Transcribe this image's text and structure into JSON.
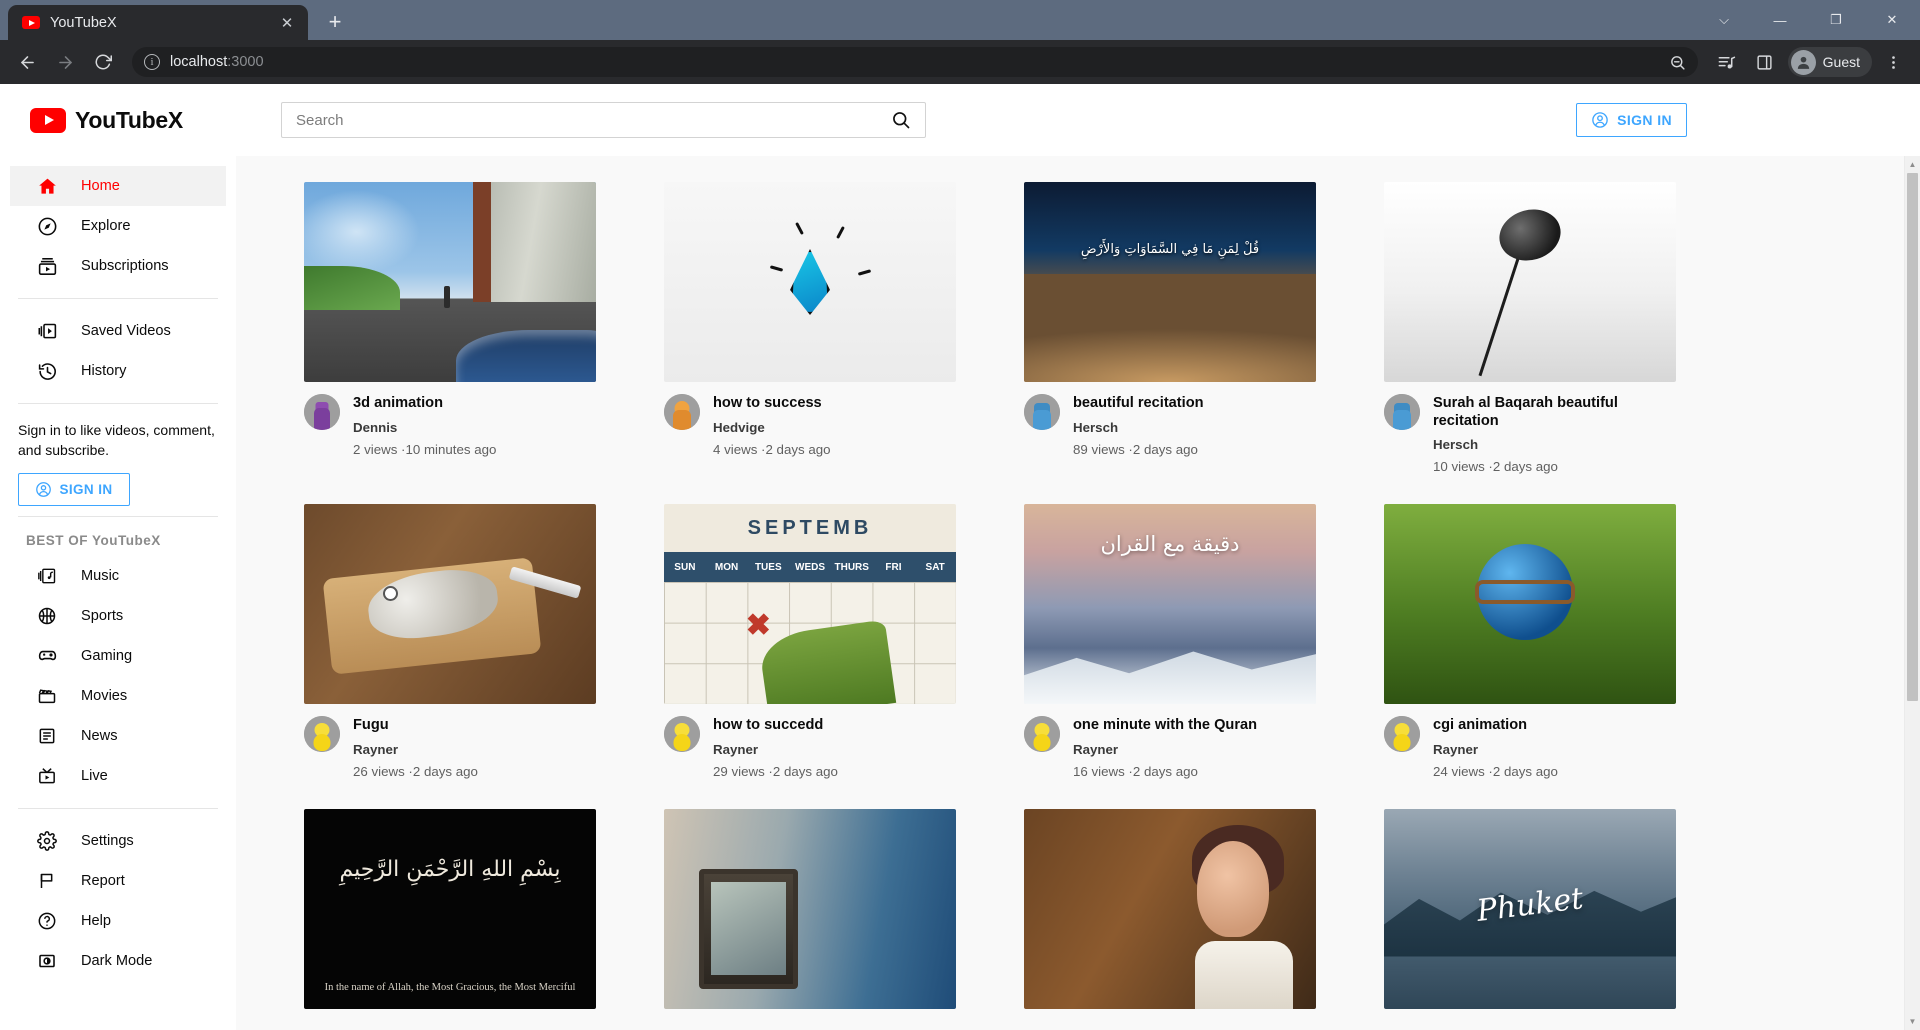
{
  "browser": {
    "tab": {
      "title": "YouTubeX",
      "favicon": "youtube-favicon",
      "close_label": "✕"
    },
    "new_tab_label": "+",
    "window_controls": {
      "minimize": "—",
      "maximize": "❐",
      "close": "✕",
      "restore_down": "⌵"
    },
    "nav": {
      "back": "←",
      "forward": "→",
      "reload": "⟳"
    },
    "omnibox": {
      "info_icon": "ⓘ",
      "url_host": "localhost",
      "url_port": ":3000"
    },
    "toolbar_icons": [
      "search-icon",
      "media-playlist-icon",
      "side-panel-icon",
      "more-menu-icon"
    ],
    "profile": {
      "name": "Guest",
      "avatar": "person-icon"
    }
  },
  "header": {
    "brand": "YouTubeX",
    "search": {
      "placeholder": "Search",
      "value": ""
    },
    "sign_in_label": "SIGN IN"
  },
  "sidebar": {
    "primary": [
      {
        "label": "Home",
        "icon": "home-icon",
        "active": true
      },
      {
        "label": "Explore",
        "icon": "compass-icon",
        "active": false
      },
      {
        "label": "Subscriptions",
        "icon": "subscriptions-icon",
        "active": false
      }
    ],
    "library": [
      {
        "label": "Saved Videos",
        "icon": "saved-videos-icon",
        "active": false
      },
      {
        "label": "History",
        "icon": "history-icon",
        "active": false
      }
    ],
    "signin_prompt": "Sign in to like videos, comment, and subscribe.",
    "signin_label": "SIGN IN",
    "section_title": "BEST OF YouTubeX",
    "categories": [
      {
        "label": "Music",
        "icon": "music-icon"
      },
      {
        "label": "Sports",
        "icon": "sports-icon"
      },
      {
        "label": "Gaming",
        "icon": "gaming-icon"
      },
      {
        "label": "Movies",
        "icon": "movies-icon"
      },
      {
        "label": "News",
        "icon": "news-icon"
      },
      {
        "label": "Live",
        "icon": "live-icon"
      }
    ],
    "settings": [
      {
        "label": "Settings",
        "icon": "gear-icon"
      },
      {
        "label": "Report",
        "icon": "flag-icon"
      },
      {
        "label": "Help",
        "icon": "help-icon"
      },
      {
        "label": "Dark Mode",
        "icon": "dark-mode-icon"
      }
    ]
  },
  "videos": [
    {
      "title": "3d animation",
      "channel": "Dennis",
      "views": "2 views",
      "age": "10 minutes ago",
      "thumb": "t-3d",
      "avatar": "av-purple"
    },
    {
      "title": "how to success",
      "channel": "Hedvige",
      "views": "4 views",
      "age": "2 days ago",
      "thumb": "t-drop",
      "avatar": "av-orange"
    },
    {
      "title": "beautiful recitation",
      "channel": "Hersch",
      "views": "89 views",
      "age": "2 days ago",
      "thumb": "t-earth",
      "avatar": "av-blue",
      "overlay_text": "قُلْ لِمَنِ مَا فِي السَّمَاوَاتِ وَالأَرْضِ"
    },
    {
      "title": "Surah al Baqarah beautiful recitation",
      "channel": "Hersch",
      "views": "10 views",
      "age": "2 days ago",
      "thumb": "t-mic",
      "avatar": "av-blue"
    },
    {
      "title": "Fugu",
      "channel": "Rayner",
      "views": "26 views",
      "age": "2 days ago",
      "thumb": "t-fish",
      "avatar": "av-yellow"
    },
    {
      "title": "how to succedd",
      "channel": "Rayner",
      "views": "29 views",
      "age": "2 days ago",
      "thumb": "t-cal",
      "avatar": "av-yellow",
      "overlay_text": "SEPTEMB"
    },
    {
      "title": "one minute with the Quran",
      "channel": "Rayner",
      "views": "16 views",
      "age": "2 days ago",
      "thumb": "t-quran",
      "avatar": "av-yellow",
      "overlay_text": "دقيقة مع القران"
    },
    {
      "title": "cgi animation",
      "channel": "Rayner",
      "views": "24 views",
      "age": "2 days ago",
      "thumb": "t-cgi",
      "avatar": "av-yellow"
    },
    {
      "title": "",
      "channel": "",
      "views": "",
      "age": "",
      "thumb": "t-bism",
      "avatar": "av-yellow",
      "overlay_text": "بِسْمِ اللهِ الرَّحْمَنِ الرَّحِيمِ",
      "overlay_sub": "In the name of Allah, the Most Gracious, the Most Merciful"
    },
    {
      "title": "",
      "channel": "",
      "views": "",
      "age": "",
      "thumb": "t-kitchen",
      "avatar": "av-yellow"
    },
    {
      "title": "",
      "channel": "",
      "views": "",
      "age": "",
      "thumb": "t-rat",
      "avatar": "av-yellow"
    },
    {
      "title": "",
      "channel": "",
      "views": "",
      "age": "",
      "thumb": "t-phuket",
      "avatar": "av-yellow",
      "overlay_text": "Phuket"
    }
  ],
  "calendar_days": [
    "SUN",
    "MON",
    "TUES",
    "WEDS",
    "THURS",
    "FRI",
    "SAT"
  ],
  "colors": {
    "brand_red": "#ff0000",
    "accent_blue": "#3ea6ff",
    "page_bg": "#f9f9f9",
    "chrome_bg": "#292a2d",
    "tabstrip_bg": "#5d6b7f"
  }
}
